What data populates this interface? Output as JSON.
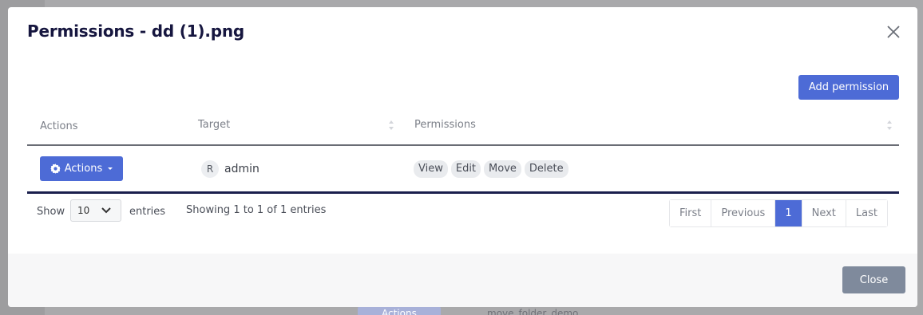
{
  "modal": {
    "title": "Permissions - dd (1).png",
    "add_permission_label": "Add permission",
    "close_label": "Close"
  },
  "table": {
    "columns": [
      "Actions",
      "Target",
      "Permissions"
    ],
    "rows": [
      {
        "actions_label": "Actions",
        "target_initial": "R",
        "target_name": "admin",
        "permissions": [
          "View",
          "Edit",
          "Move",
          "Delete"
        ]
      }
    ]
  },
  "footer": {
    "show_label": "Show",
    "entries_value": "10",
    "entries_label": "entries",
    "info": "Showing 1 to 1 of 1 entries"
  },
  "pagination": {
    "first": "First",
    "previous": "Previous",
    "current": "1",
    "next": "Next",
    "last": "Last"
  },
  "background": {
    "actions_label": "Actions",
    "folder_label": "move_folder_demo"
  },
  "colors": {
    "primary": "#4d6bd6",
    "title": "#16163f",
    "close_button": "#7f8a9c"
  }
}
